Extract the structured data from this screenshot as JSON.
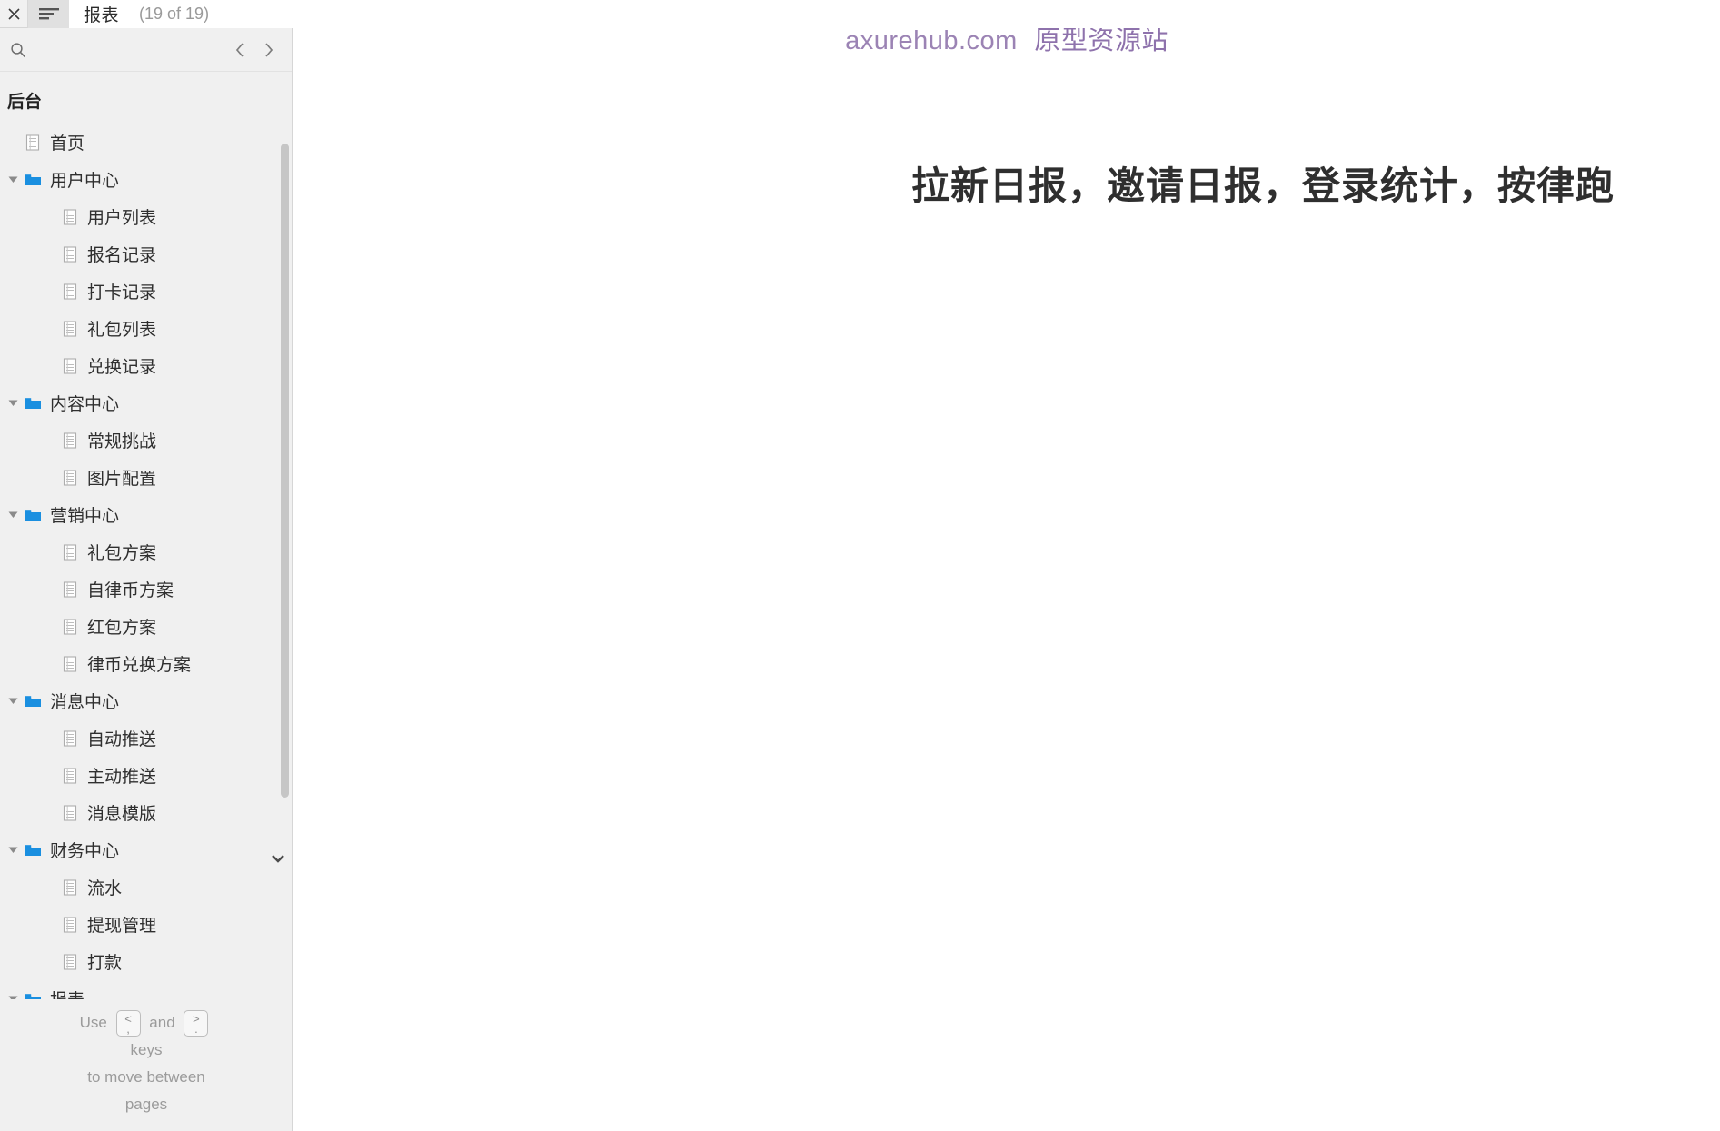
{
  "topbar": {
    "close_icon": "close-icon",
    "menu_icon": "hamburger-menu-icon",
    "title": "报表",
    "counter": "(19 of 19)"
  },
  "sidebar": {
    "search": {
      "icon": "search-icon",
      "value": "",
      "placeholder": ""
    },
    "prev_icon": "chevron-left-icon",
    "next_icon": "chevron-right-icon",
    "tree_title": "后台",
    "scroll_down_icon": "chevron-down-icon",
    "items": [
      {
        "label": "首页",
        "type": "page",
        "depth": 1,
        "expanded": null
      },
      {
        "label": "用户中心",
        "type": "folder",
        "depth": 1,
        "expanded": true
      },
      {
        "label": "用户列表",
        "type": "page",
        "depth": 2,
        "expanded": null
      },
      {
        "label": "报名记录",
        "type": "page",
        "depth": 2,
        "expanded": null
      },
      {
        "label": "打卡记录",
        "type": "page",
        "depth": 2,
        "expanded": null
      },
      {
        "label": "礼包列表",
        "type": "page",
        "depth": 2,
        "expanded": null
      },
      {
        "label": "兑换记录",
        "type": "page",
        "depth": 2,
        "expanded": null
      },
      {
        "label": "内容中心",
        "type": "folder",
        "depth": 1,
        "expanded": true
      },
      {
        "label": "常规挑战",
        "type": "page",
        "depth": 2,
        "expanded": null
      },
      {
        "label": "图片配置",
        "type": "page",
        "depth": 2,
        "expanded": null
      },
      {
        "label": "营销中心",
        "type": "folder",
        "depth": 1,
        "expanded": true
      },
      {
        "label": "礼包方案",
        "type": "page",
        "depth": 2,
        "expanded": null
      },
      {
        "label": "自律币方案",
        "type": "page",
        "depth": 2,
        "expanded": null
      },
      {
        "label": "红包方案",
        "type": "page",
        "depth": 2,
        "expanded": null
      },
      {
        "label": "律币兑换方案",
        "type": "page",
        "depth": 2,
        "expanded": null
      },
      {
        "label": "消息中心",
        "type": "folder",
        "depth": 1,
        "expanded": true
      },
      {
        "label": "自动推送",
        "type": "page",
        "depth": 2,
        "expanded": null
      },
      {
        "label": "主动推送",
        "type": "page",
        "depth": 2,
        "expanded": null
      },
      {
        "label": "消息模版",
        "type": "page",
        "depth": 2,
        "expanded": null
      },
      {
        "label": "财务中心",
        "type": "folder",
        "depth": 1,
        "expanded": true
      },
      {
        "label": "流水",
        "type": "page",
        "depth": 2,
        "expanded": null
      },
      {
        "label": "提现管理",
        "type": "page",
        "depth": 2,
        "expanded": null
      },
      {
        "label": "打款",
        "type": "page",
        "depth": 2,
        "expanded": null
      },
      {
        "label": "报表",
        "type": "folder",
        "depth": 1,
        "expanded": true
      }
    ],
    "footer": {
      "use_word": "Use",
      "key_prev_top": "<",
      "key_prev_bottom": ",",
      "and_word": "and",
      "key_next_top": ">",
      "key_next_bottom": ".",
      "keys_word": "keys",
      "line3": "to move between",
      "line4": "pages"
    }
  },
  "main": {
    "watermark_domain": "axurehub.com",
    "watermark_text": "原型资源站",
    "heading": "拉新日报，邀请日报，登录统计，按律跑"
  },
  "colors": {
    "folder_blue": "#1a8fe0",
    "watermark_purple": "#8e72ac",
    "heading_dark": "#2f2f2f",
    "sidebar_bg": "#f0f0f0"
  }
}
